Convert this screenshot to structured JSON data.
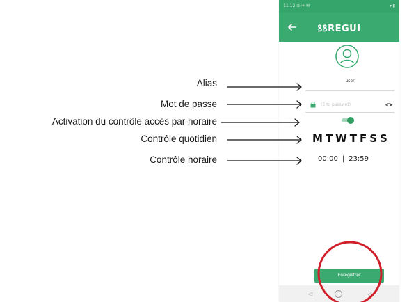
{
  "annotations": {
    "alias": "Alias",
    "password": "Mot de passe",
    "activation": "Activation du contrôle accès par horaire",
    "daily": "Contrôle quotidien",
    "hourly": "Contrôle horaire"
  },
  "phone": {
    "status_left": "11:12 ⊕ ✈ ✉",
    "status_right": "▾ ▮",
    "title": "ꝸꝸREGUI",
    "alias_value": "user",
    "password_placeholder": "(3 to passwrd)",
    "days": [
      "M",
      "T",
      "W",
      "T",
      "F",
      "S",
      "S"
    ],
    "time_start": "00:00",
    "time_separator": "|",
    "time_end": "23:59",
    "save_label": "Enregistrer",
    "nav_back": "◁",
    "nav_recent": "◁"
  },
  "colors": {
    "brand_green": "#3aaa70",
    "highlight_circle": "#d01f2b"
  },
  "icons": {
    "back": "arrow-left-icon",
    "avatar": "user-circle-icon",
    "lock": "lock-icon",
    "eye": "eye-icon",
    "home": "circle-home-icon"
  }
}
